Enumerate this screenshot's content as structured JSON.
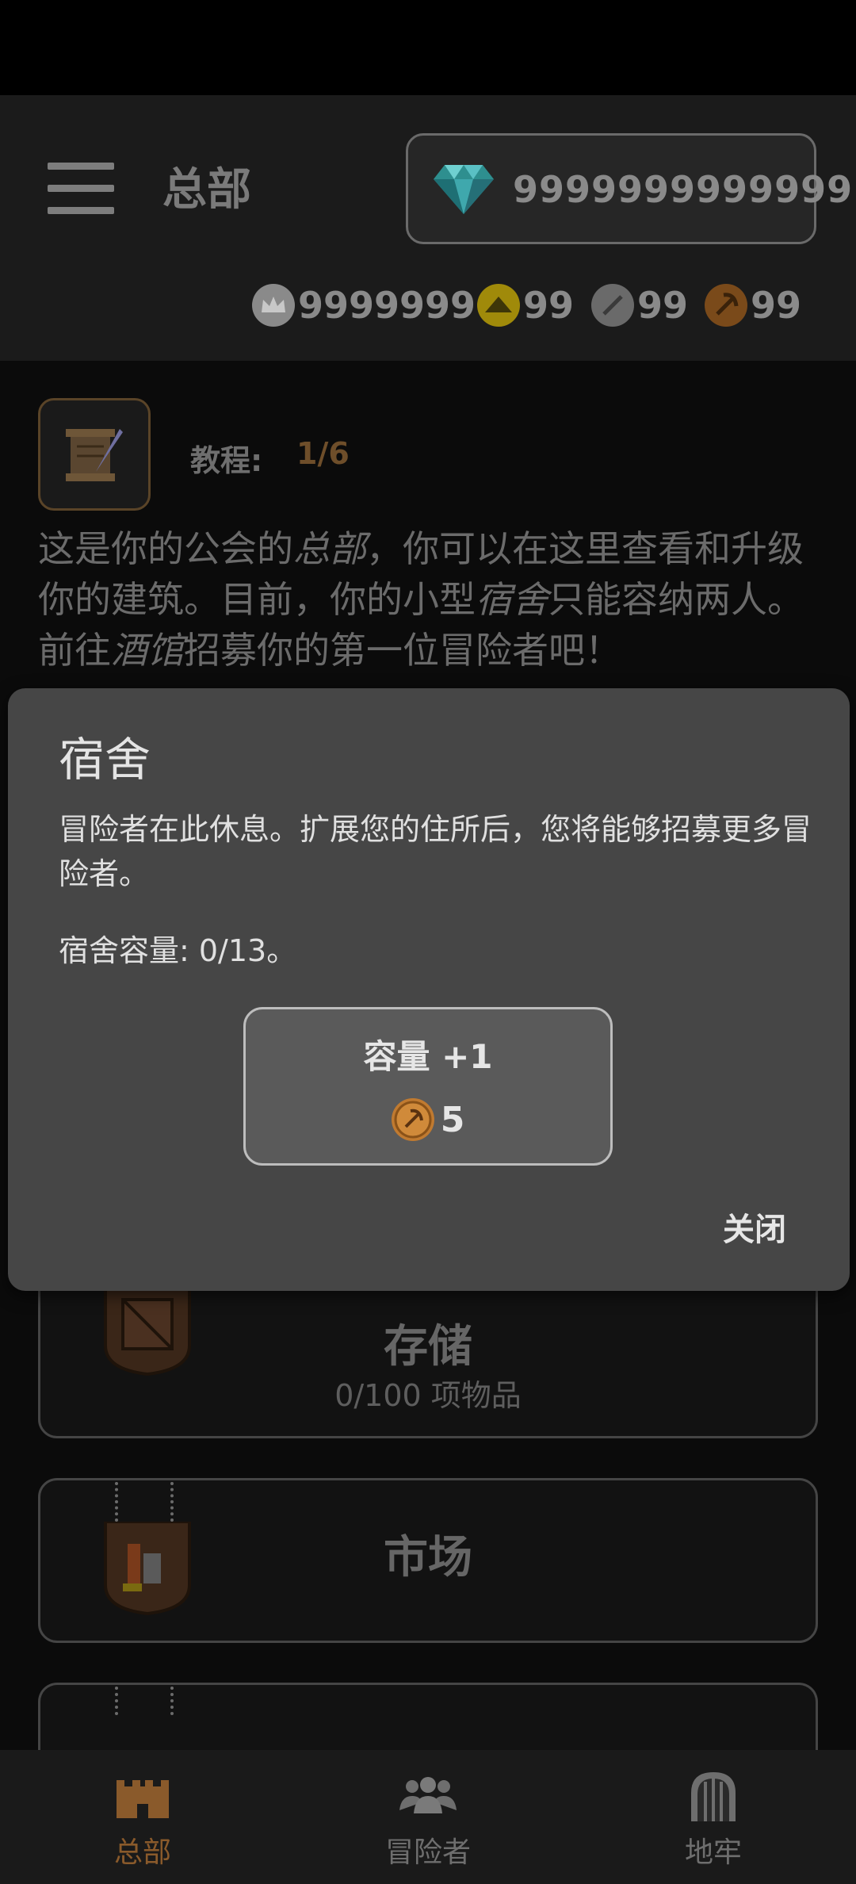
{
  "header": {
    "title": "总部",
    "gems": "9999999999999",
    "currencies": [
      {
        "icon": "crown-coin-icon",
        "value": "9999999"
      },
      {
        "icon": "gold-coin-icon",
        "value": "99"
      },
      {
        "icon": "sword-coin-icon",
        "value": "99"
      },
      {
        "icon": "pickaxe-coin-icon",
        "value": "99"
      }
    ]
  },
  "tutorial": {
    "label": "教程:",
    "progress": "1/6",
    "text_1": "这是你的公会的",
    "text_em1": "总部",
    "text_2": "，你可以在这里查看和升级你的建筑。目前，你的小型",
    "text_em2": "宿舍",
    "text_3": "只能容纳两人。前往",
    "text_em3": "酒馆",
    "text_4": "招募你的第一位冒险者吧！"
  },
  "buildings": [
    {
      "name": "存储",
      "sub": "0/100 项物品"
    },
    {
      "name": "市场",
      "sub": ""
    }
  ],
  "modal": {
    "title": "宿舍",
    "body": "冒险者在此休息。扩展您的住所后，您将能够招募更多冒险者。",
    "capacity": "宿舍容量: 0/13。",
    "upgrade_label": "容量 +1",
    "upgrade_cost": "5",
    "close_label": "关闭"
  },
  "nav": {
    "items": [
      {
        "label": "总部",
        "active": true
      },
      {
        "label": "冒险者",
        "active": false
      },
      {
        "label": "地牢",
        "active": false
      }
    ]
  },
  "colors": {
    "accent": "#8a5a2b",
    "modal_bg": "#464646",
    "background": "#0b0b0b"
  }
}
